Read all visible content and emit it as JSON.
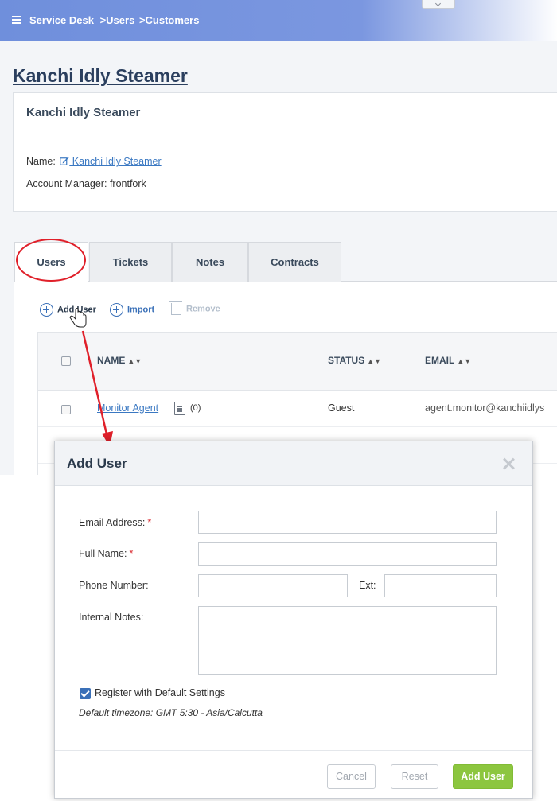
{
  "header": {
    "breadcrumb": [
      "Service Desk",
      "Users",
      "Customers"
    ],
    "separator": ">"
  },
  "customer": {
    "title": "Kanchi Idly Steamer",
    "card_heading": "Kanchi Idly Steamer",
    "name_label": "Name:",
    "name_value": "Kanchi Idly Steamer",
    "manager_label": "Account Manager:",
    "manager_value": "frontfork"
  },
  "tabs": [
    {
      "label": "Users",
      "active": true
    },
    {
      "label": "Tickets",
      "active": false
    },
    {
      "label": "Notes",
      "active": false
    },
    {
      "label": "Contracts",
      "active": false
    }
  ],
  "actions": {
    "add_user": "Add User",
    "import": "Import",
    "remove": "Remove"
  },
  "table": {
    "columns": [
      "NAME",
      "STATUS",
      "EMAIL"
    ],
    "rows": [
      {
        "name": "Monitor Agent",
        "notes_count": "(0)",
        "status": "Guest",
        "email": "agent.monitor@kanchiidlys"
      }
    ]
  },
  "modal": {
    "title": "Add User",
    "fields": {
      "email_label": "Email Address:",
      "full_name_label": "Full Name:",
      "phone_label": "Phone Number:",
      "ext_label": "Ext:",
      "notes_label": "Internal Notes:",
      "required_mark": "*",
      "email_value": "",
      "full_name_value": "",
      "phone_value": "",
      "ext_value": "",
      "notes_value": ""
    },
    "register_label": "Register with Default Settings",
    "register_checked": true,
    "timezone_text": "Default timezone: GMT 5:30 - Asia/Calcutta",
    "buttons": {
      "cancel": "Cancel",
      "reset": "Reset",
      "add_user": "Add User"
    }
  },
  "colors": {
    "accent": "#3a70b8",
    "primary_button": "#8cc63f",
    "annotation": "#e0202a",
    "topbar": "#6f8fdc"
  }
}
